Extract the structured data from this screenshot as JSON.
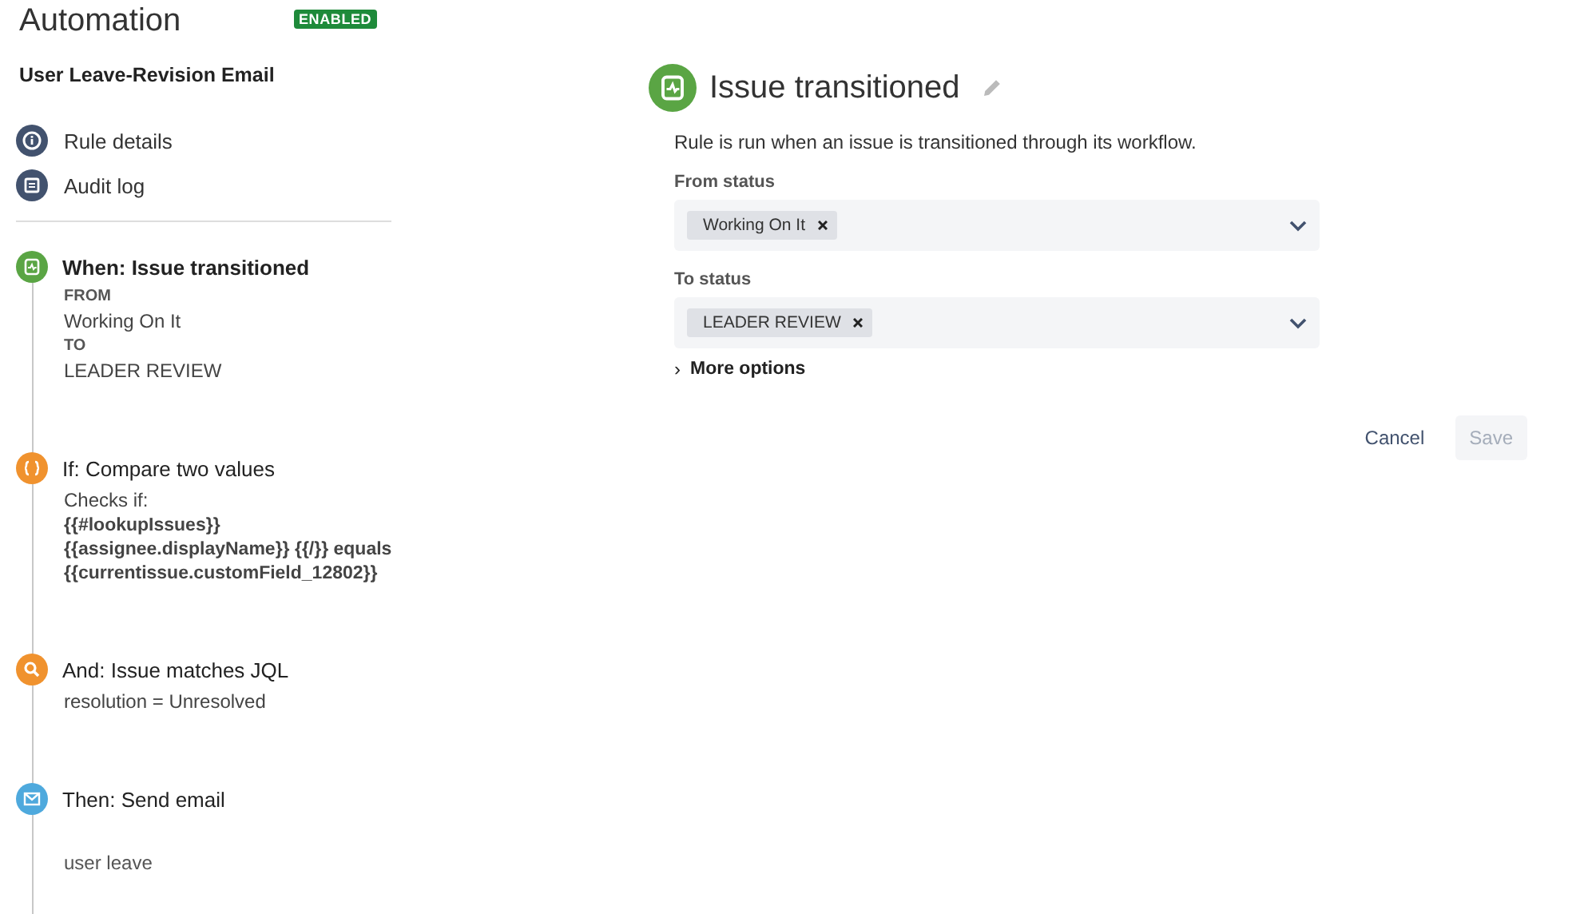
{
  "header": {
    "title": "Automation",
    "badge": "ENABLED"
  },
  "rule_name": "User Leave-Revision Email",
  "nav": [
    {
      "kind": "info",
      "label": "Rule details"
    },
    {
      "kind": "log",
      "label": "Audit log"
    }
  ],
  "steps": [
    {
      "kind": "trigger",
      "title": "When: Issue transitioned",
      "selected": true,
      "details": [
        {
          "kind": "label",
          "text": "FROM"
        },
        {
          "kind": "value",
          "text": "Working On It"
        },
        {
          "kind": "label",
          "text": "TO"
        },
        {
          "kind": "value",
          "text": "LEADER REVIEW"
        }
      ]
    },
    {
      "kind": "condition",
      "title": "If: Compare two values",
      "selected": false,
      "details": [
        {
          "kind": "value",
          "text": "Checks if:"
        },
        {
          "kind": "code",
          "text": "{{#lookupIssues}}"
        },
        {
          "kind": "code",
          "text": "{{assignee.displayName}} {{/}} equals"
        },
        {
          "kind": "code",
          "text": "{{currentissue.customField_12802}}"
        }
      ]
    },
    {
      "kind": "jql",
      "title": "And: Issue matches JQL",
      "selected": false,
      "details": [
        {
          "kind": "value",
          "text": "resolution = Unresolved"
        }
      ]
    },
    {
      "kind": "email",
      "title": "Then: Send email",
      "selected": false,
      "details": [
        {
          "kind": "note",
          "text": "user leave"
        }
      ]
    }
  ],
  "panel": {
    "title": "Issue transitioned",
    "description": "Rule is run when an issue is transitioned through its workflow.",
    "fields": [
      {
        "label": "From status",
        "tags": [
          "Working On It"
        ]
      },
      {
        "label": "To status",
        "tags": [
          "LEADER REVIEW"
        ]
      }
    ],
    "more_options": "More options",
    "more_expanded": false,
    "expand_glyph": "›",
    "buttons": [
      {
        "kind": "link",
        "label": "Cancel",
        "disabled": false
      },
      {
        "kind": "primary",
        "label": "Save",
        "disabled": true
      }
    ]
  }
}
